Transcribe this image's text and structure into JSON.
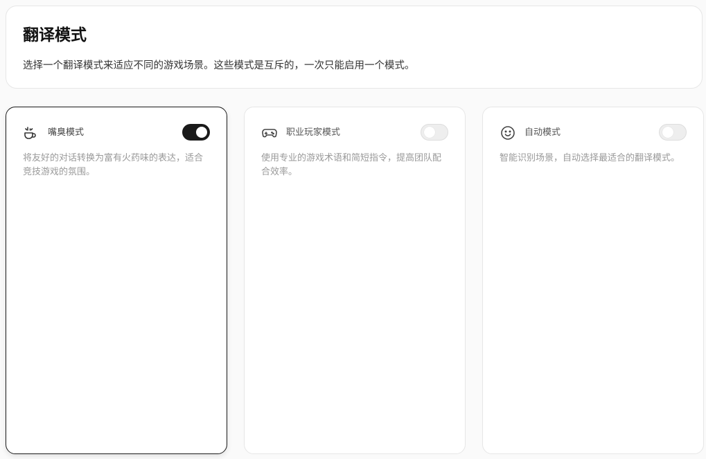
{
  "header": {
    "title": "翻译模式",
    "description": "选择一个翻译模式来适应不同的游戏场景。这些模式是互斥的，一次只能启用一个模式。"
  },
  "modes": [
    {
      "icon": "smoke-cup-icon",
      "title": "嘴臭模式",
      "description": "将友好的对话转换为富有火药味的表达，适合竞技游戏的氛围。",
      "enabled": true
    },
    {
      "icon": "gamepad-icon",
      "title": "职业玩家模式",
      "description": "使用专业的游戏术语和简短指令，提高团队配合效率。",
      "enabled": false
    },
    {
      "icon": "smiley-icon",
      "title": "自动模式",
      "description": "智能识别场景，自动选择最适合的翻译模式。",
      "enabled": false
    }
  ],
  "colors": {
    "toggle_on": "#1a1a1a",
    "toggle_off": "#eeeeee",
    "active_border": "#1a1a1a"
  }
}
